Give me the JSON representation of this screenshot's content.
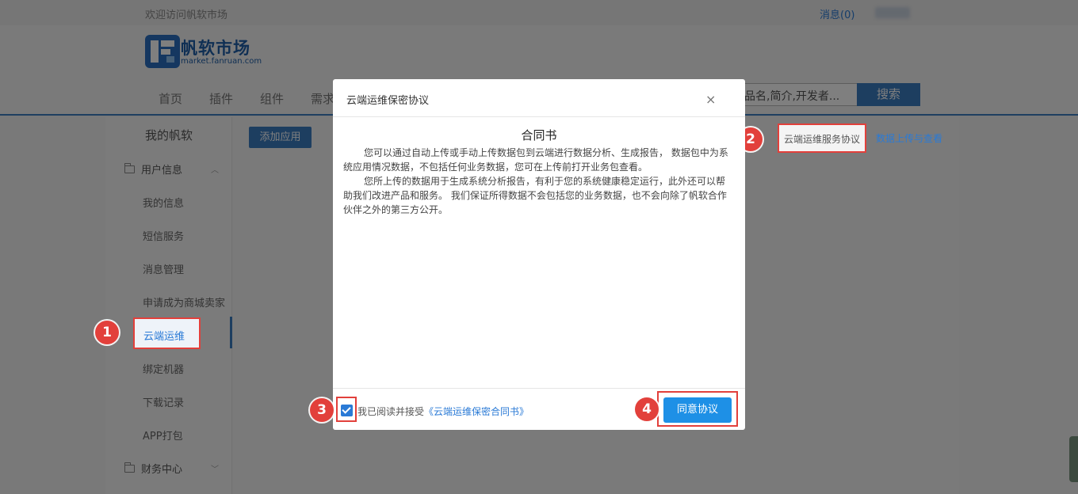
{
  "topbar": {
    "welcome": "欢迎访问帆软市场",
    "messages": "消息(0)"
  },
  "header": {
    "brand": "帆软市场",
    "brand_url": "market.fanruan.com",
    "nav": [
      "首页",
      "插件",
      "组件",
      "需求"
    ],
    "search_placeholder": "品名,简介,开发者...",
    "search_button": "搜索"
  },
  "sidebar": {
    "title": "我的帆软",
    "group1": "用户信息",
    "items": [
      "我的信息",
      "短信服务",
      "消息管理",
      "申请成为商城卖家",
      "云端运维",
      "绑定机器",
      "下载记录",
      "APP打包"
    ],
    "group2": "财务中心"
  },
  "main": {
    "add_button": "添加应用",
    "link_agreement": "云端运维服务协议",
    "link_upload": "数据上传与查看"
  },
  "modal": {
    "title": "云端运维保密协议",
    "close": "×",
    "contract_title": "合同书",
    "paragraph1": "您可以通过自动上传或手动上传数据包到云端进行数据分析、生成报告， 数据包中为系统应用情况数据，不包括任何业务数据，您可在上传前打开业务包查看。",
    "paragraph2": "您所上传的数据用于生成系统分析报告，有利于您的系统健康稳定运行，此外还可以帮助我们改进产品和服务。 我们保证所得数据不会包括您的业务数据，也不会向除了帆软合作伙伴之外的第三方公开。",
    "accept_prefix": "我已阅读并接受",
    "accept_link": "《云端运维保密合同书》",
    "agree_button": "同意协议"
  },
  "markers": [
    "1",
    "2",
    "3",
    "4"
  ],
  "colors": {
    "accent": "#3b7cc0",
    "highlight": "#e2403b",
    "primary_button": "#1e90e6"
  }
}
